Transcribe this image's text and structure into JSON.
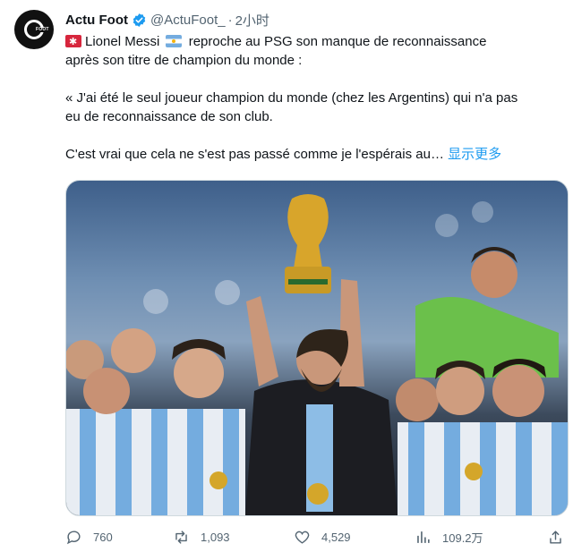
{
  "tweet": {
    "author_name": "Actu Foot",
    "handle": "@ActuFoot_",
    "separator": "·",
    "time": "2小时",
    "avatar_text": "FOOT",
    "line1": "Lionel Messi",
    "line1b": "reproche au PSG son manque de reconnaissance",
    "line2": "après son titre de champion du monde :",
    "quote1": "« J'ai été le seul joueur champion du monde (chez les Argentins) qui n'a pas",
    "quote2": "eu de reconnaissance de son club.",
    "quote3": "C'est vrai que cela ne s'est pas passé comme je l'espérais au…",
    "show_more": "显示更多"
  },
  "media": {
    "description_icon": "photo"
  },
  "actions": {
    "replies": "760",
    "retweets": "1,093",
    "likes": "4,529",
    "views": "109.2万"
  },
  "colors": {
    "accent": "#1d9bf0",
    "secondary_text": "#536471"
  }
}
